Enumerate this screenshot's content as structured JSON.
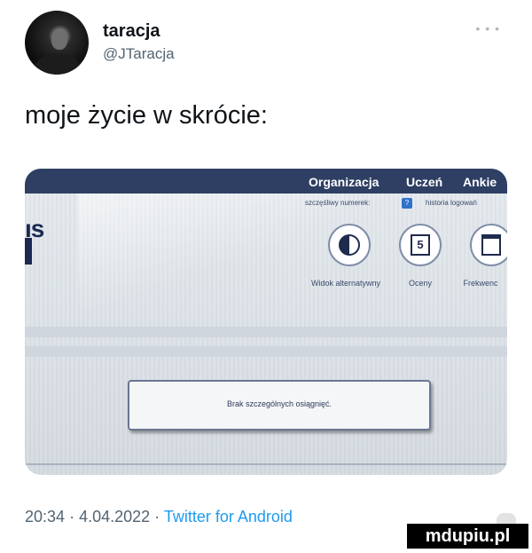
{
  "author": {
    "name": "taracja",
    "handle": "@JTaracja",
    "more_icon": "more-options-icon"
  },
  "tweet": {
    "text": "moje życie w skrócie:",
    "time": "20:34",
    "date": "4.04.2022",
    "separator": "·",
    "source": "Twitter for Android"
  },
  "photo": {
    "nav": [
      "Organizacja",
      "Uczeń",
      "Ankie"
    ],
    "sub_left": "szczęśliwy numerek:",
    "sub_badge": "?",
    "sub_right": "historia logowań",
    "left_fragment": "ıs",
    "buttons": [
      {
        "icon": "eye-icon",
        "label": "Widok alternatywny"
      },
      {
        "icon": "grade-icon",
        "glyph": "5",
        "label": "Oceny"
      },
      {
        "icon": "calendar-icon",
        "label": "Frekwenc"
      }
    ],
    "achievements": "Brak szczególnych osiągnięć."
  },
  "watermark": "mdupiu.pl"
}
